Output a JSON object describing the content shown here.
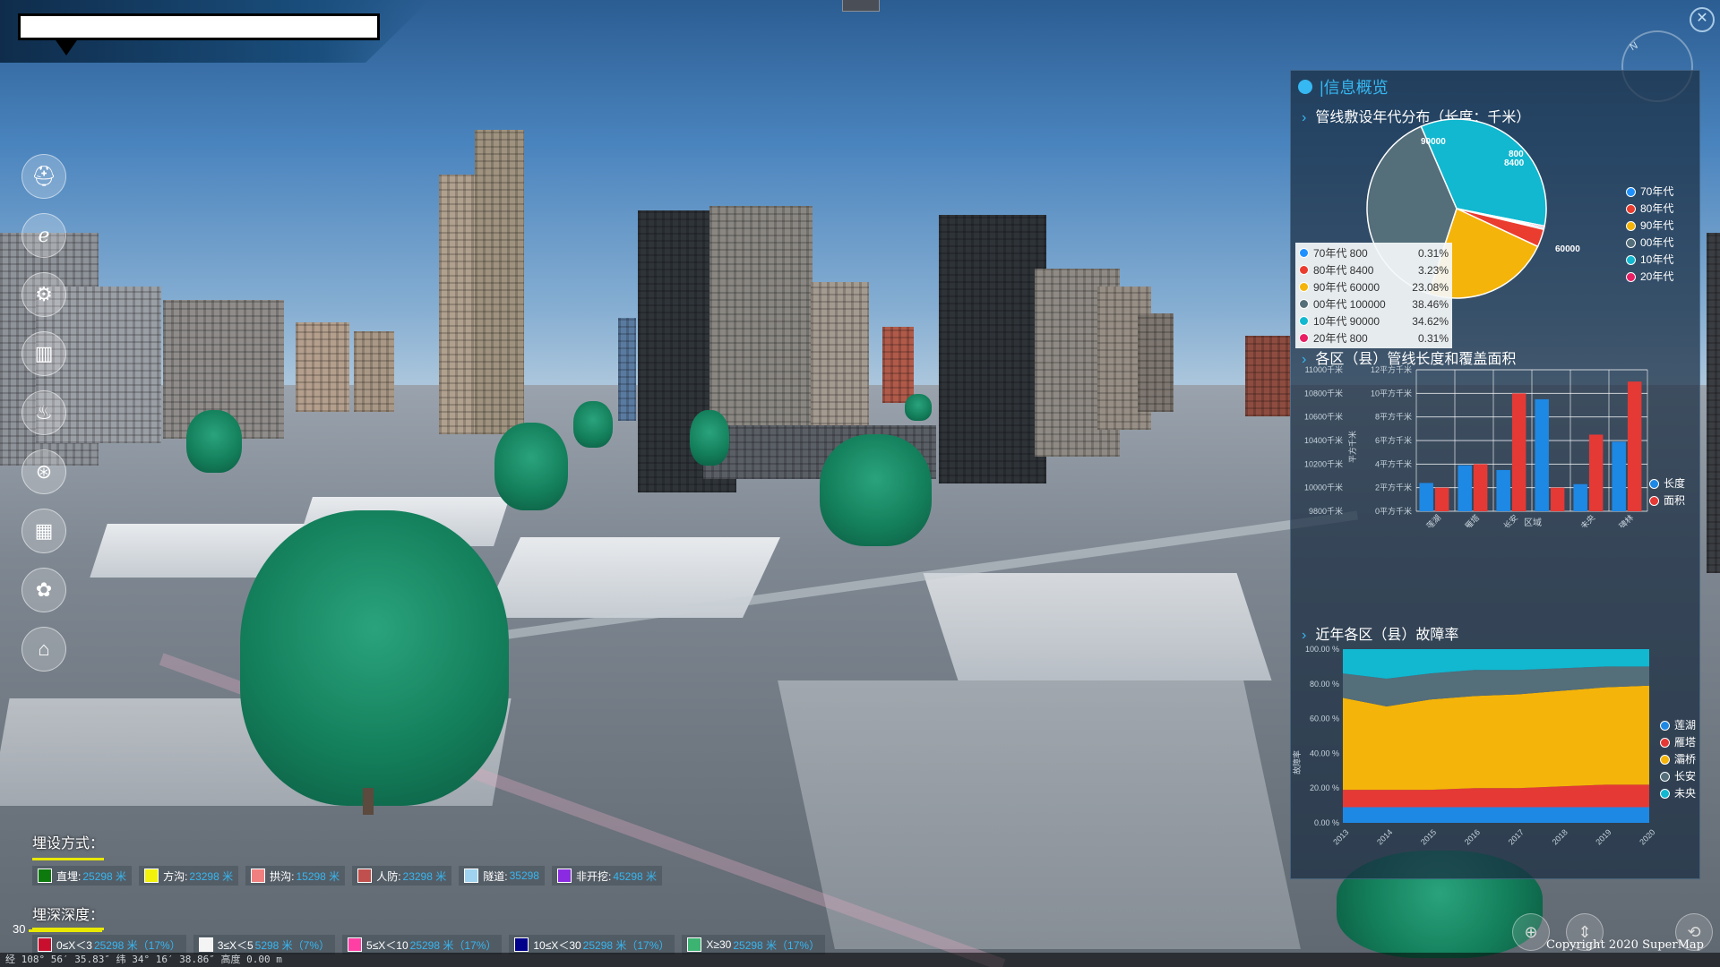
{
  "panel": {
    "title": "|信息概览",
    "pie_section_title": "管线敷设年代分布（长度：千米）",
    "bar_section_title": "各区（县）管线长度和覆盖面积",
    "area_section_title": "近年各区（县）故障率"
  },
  "pie_chart": {
    "chart_data": {
      "type": "pie",
      "slices": [
        {
          "label": "70年代",
          "value": 800,
          "percent": "0.31%",
          "color": "#1e90ff"
        },
        {
          "label": "80年代",
          "value": 8400,
          "percent": "3.23%",
          "color": "#ea3c2f"
        },
        {
          "label": "90年代",
          "value": 60000,
          "percent": "23.08%",
          "color": "#f5b40a"
        },
        {
          "label": "00年代",
          "value": 100000,
          "percent": "38.46%",
          "color": "#546e7a"
        },
        {
          "label": "10年代",
          "value": 90000,
          "percent": "34.62%",
          "color": "#11b8d0"
        },
        {
          "label": "20年代",
          "value": 800,
          "percent": "0.31%",
          "color": "#e91e63"
        }
      ],
      "data_labels": [
        "90000",
        "800",
        "8400",
        "60000"
      ],
      "legend_position": "right"
    },
    "tooltip_rows": [
      {
        "label": "70年代  800",
        "pct": "0.31%"
      },
      {
        "label": "80年代  8400",
        "pct": "3.23%"
      },
      {
        "label": "90年代  60000",
        "pct": "23.08%"
      },
      {
        "label": "00年代  100000",
        "pct": "38.46%"
      },
      {
        "label": "10年代  90000",
        "pct": "34.62%"
      },
      {
        "label": "20年代  800",
        "pct": "0.31%"
      }
    ]
  },
  "bar_chart": {
    "chart_data": {
      "type": "bar",
      "categories": [
        "莲湖",
        "雁塔",
        "长安",
        "",
        "未央",
        "碑林"
      ],
      "series": [
        {
          "name": "长度",
          "color": "#1e88e5",
          "axis": "left",
          "values": [
            10040,
            10190,
            10150,
            10750,
            10030,
            10390
          ]
        },
        {
          "name": "面积",
          "color": "#e53935",
          "axis": "right",
          "values": [
            20000,
            40000,
            100000,
            20000,
            65000,
            110000
          ]
        }
      ],
      "y_left": {
        "ticks": [
          "9800千米",
          "10000千米",
          "10200千米",
          "10400千米",
          "10600千米",
          "10800千米",
          "11000千米"
        ],
        "min": 9800,
        "max": 11000
      },
      "y_right": {
        "label": "平方千米",
        "ticks": [
          "0平方千米",
          "2平方千米",
          "4平方千米",
          "6平方千米",
          "8平方千米",
          "10平方千米",
          "12平方千米"
        ],
        "min": 0,
        "max": 120000
      },
      "xlabel": "区域",
      "legend_position": "right",
      "grid": true
    }
  },
  "area_chart": {
    "chart_data": {
      "type": "area",
      "stacked": true,
      "normalized": true,
      "x": [
        "2013",
        "2014",
        "2015",
        "2016",
        "2017",
        "2018",
        "2019",
        "2020"
      ],
      "series": [
        {
          "name": "莲湖",
          "color": "#1e88e5",
          "values": [
            9,
            9,
            9,
            9,
            9,
            9,
            9,
            9
          ]
        },
        {
          "name": "雁塔",
          "color": "#e53935",
          "values": [
            10,
            10,
            10,
            11,
            11,
            12,
            13,
            13
          ]
        },
        {
          "name": "灞桥",
          "color": "#f5b40a",
          "values": [
            53,
            48,
            52,
            53,
            54,
            55,
            56,
            57
          ]
        },
        {
          "name": "长安",
          "color": "#546e7a",
          "values": [
            14,
            16,
            15,
            15,
            14,
            13,
            12,
            11
          ]
        },
        {
          "name": "未央",
          "color": "#11b8d0",
          "values": [
            14,
            17,
            14,
            12,
            12,
            11,
            10,
            10
          ]
        }
      ],
      "y_ticks": [
        "0.00 %",
        "20.00 %",
        "40.00 %",
        "60.00 %",
        "80.00 %",
        "100.00 %"
      ],
      "ylabel": "故障率",
      "legend_position": "right"
    }
  },
  "legend_burial": {
    "title": "埋设方式：",
    "items": [
      {
        "label": "直埋:",
        "value": "25298 米",
        "color": "#0c7a0c"
      },
      {
        "label": "方沟:",
        "value": "23298 米",
        "color": "#f2f20a"
      },
      {
        "label": "拱沟:",
        "value": "15298 米",
        "color": "#f08080"
      },
      {
        "label": "人防:",
        "value": "23298 米",
        "color": "#c0504d"
      },
      {
        "label": "隧道:",
        "value": "35298",
        "color": "#9fd3f0"
      },
      {
        "label": "非开挖:",
        "value": "45298 米",
        "color": "#8a2be2"
      }
    ]
  },
  "legend_depth": {
    "title": "埋深深度：",
    "items": [
      {
        "label": "0≤X＜3",
        "value": "25298 米（17%）",
        "color": "#c8102e"
      },
      {
        "label": "3≤X＜5",
        "value": "5298 米（7%）",
        "color": "#f4f4f4"
      },
      {
        "label": "5≤X＜10",
        "value": "25298 米（17%）",
        "color": "#ff3fa4"
      },
      {
        "label": "10≤X＜30",
        "value": "25298 米（17%）",
        "color": "#00008b"
      },
      {
        "label": "X≥30",
        "value": "25298 米（17%）",
        "color": "#3cb371"
      }
    ]
  },
  "scale": {
    "zoom": "30"
  },
  "status_bar": "经 108° 56′ 35.83″ 纬 34° 16′ 38.86″ 高度 0.00 m",
  "copyright": "Copyright 2020 SuperMap",
  "compass_label": "N",
  "toolbar": [
    {
      "name": "layer-tool",
      "icon": "⛑"
    },
    {
      "name": "browser-tool",
      "icon": "ℯ"
    },
    {
      "name": "settings-tool",
      "icon": "⚙"
    },
    {
      "name": "analysis-tool",
      "icon": "▥"
    },
    {
      "name": "fire-tool",
      "icon": "♨"
    },
    {
      "name": "network-tool",
      "icon": "⊛"
    },
    {
      "name": "building-tool",
      "icon": "▦"
    },
    {
      "name": "cluster-tool",
      "icon": "✿"
    },
    {
      "name": "home-tool",
      "icon": "⌂"
    }
  ],
  "close_label": "✕"
}
